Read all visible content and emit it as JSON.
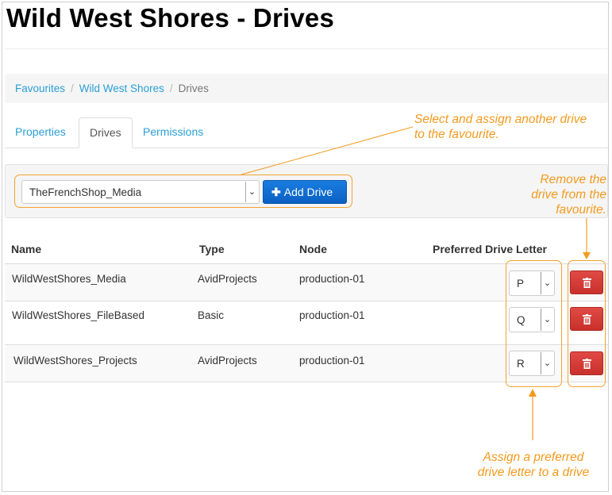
{
  "page": {
    "title": "Wild West Shores - Drives"
  },
  "breadcrumb": {
    "items": [
      {
        "label": "Favourites"
      },
      {
        "label": "Wild West Shores"
      }
    ],
    "separator": "/",
    "current": "Drives"
  },
  "tabs": [
    {
      "label": "Properties",
      "active": false
    },
    {
      "label": "Drives",
      "active": true
    },
    {
      "label": "Permissions",
      "active": false
    }
  ],
  "drive_picker": {
    "selected": "TheFrenchShop_Media",
    "add_button_label": "Add Drive",
    "add_icon": "plus-icon"
  },
  "table": {
    "headers": {
      "name": "Name",
      "type": "Type",
      "node": "Node",
      "letter": "Preferred Drive Letter"
    },
    "rows": [
      {
        "name": "WildWestShores_Media",
        "type": "AvidProjects",
        "node": "production-01",
        "letter": "P"
      },
      {
        "name": "WildWestShores_FileBased",
        "type": "Basic",
        "node": "production-01",
        "letter": "Q"
      },
      {
        "name": "WildWestShores_Projects",
        "type": "AvidProjects",
        "node": "production-01",
        "letter": "R"
      }
    ],
    "delete_icon": "trash-icon"
  },
  "annotations": {
    "select_drive": {
      "line1": "Select and assign another drive",
      "line2": "to the favourite."
    },
    "remove_drive": {
      "line1": "Remove the",
      "line2": "drive from the",
      "line3": "favourite."
    },
    "assign_letter": {
      "line1": "Assign a preferred",
      "line2": "drive letter to a drive"
    },
    "color": "#f39a1e"
  },
  "colors": {
    "link": "#2a9fd6",
    "primary_button": "#0a60c2",
    "danger_button": "#c9302c"
  }
}
